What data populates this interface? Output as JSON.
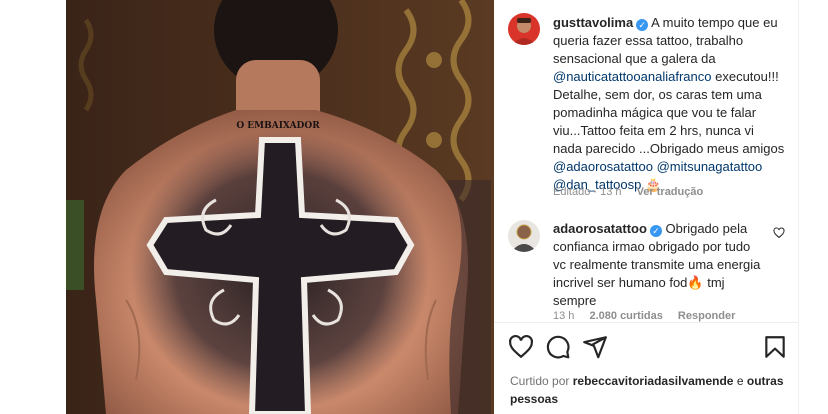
{
  "post": {
    "author": "gusttavolima",
    "caption_parts": {
      "p1": "A muito tempo que eu queria fazer essa tattoo, trabalho sensacional que a galera da",
      "m1": "@nauticatattooanaliafranco",
      "p2": "executou!!! Detalhe, sem dor, os caras tem uma pomadinha mágica que vou te falar viu...Tattoo feita em 2 hrs, nunca vi nada parecido ...Obrigado meus amigos",
      "m2": "@adaorosatattoo",
      "m3": "@mitsunagatattoo",
      "m4": "@dan_tattoosp",
      "emoji": "🎂"
    },
    "edited": "Editado · 13 h",
    "see_translation": "Ver tradução",
    "image_text": "O EMBAIXADOR"
  },
  "reply": {
    "author": "adaorosatattoo",
    "text_p1": "Obrigado pela confianca irmao obrigado por tudo vc realmente transmite uma energia incrivel ser humano fod",
    "emoji": "🔥",
    "text_p2": "tmj sempre",
    "time": "13 h",
    "likes": "2.080 curtidas",
    "reply_label": "Responder"
  },
  "likes_line": {
    "prefix": "Curtido por",
    "user": "rebeccavitoriadasilvamende",
    "conj": "e",
    "others": "outras pessoas"
  },
  "colors": {
    "text": "#262626",
    "muted": "#8e8e8e",
    "mention": "#00376b",
    "verified": "#3897f0"
  },
  "icons": [
    "heart-icon",
    "comment-icon",
    "share-icon",
    "bookmark-icon",
    "verified-icon"
  ]
}
